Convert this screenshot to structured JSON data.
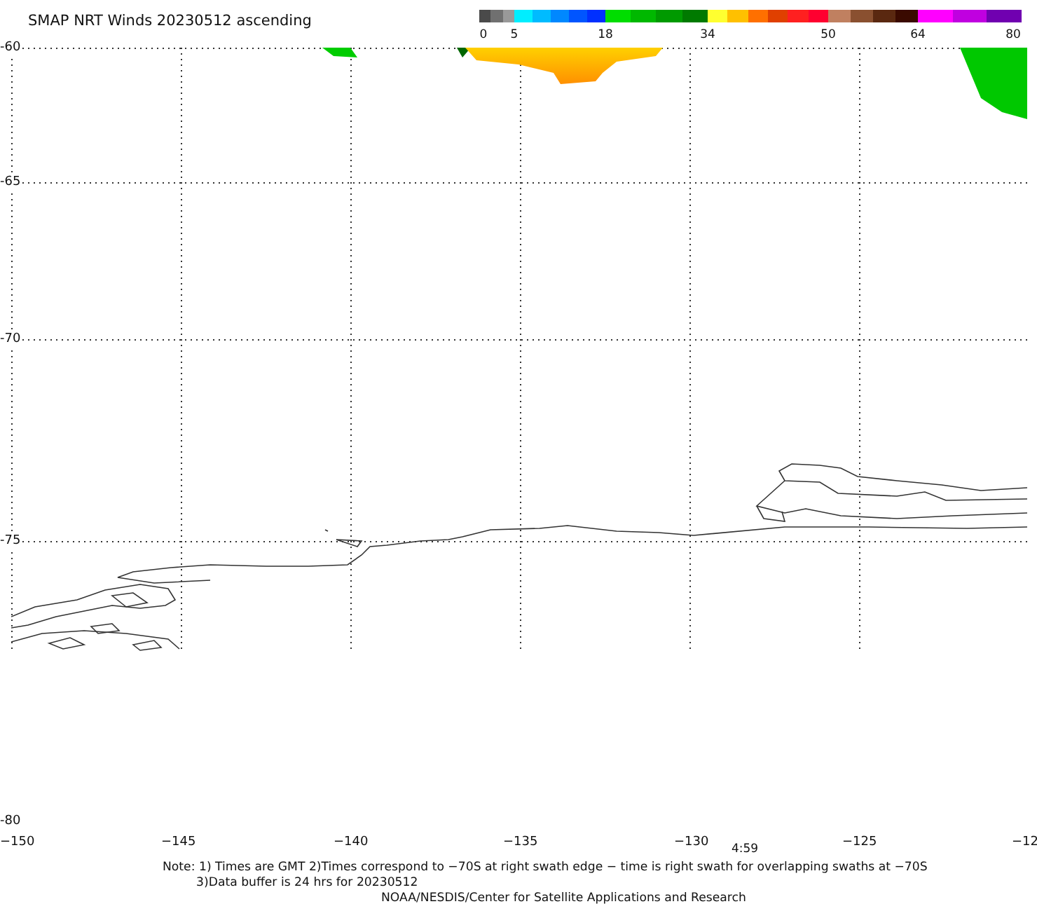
{
  "title": "SMAP NRT Winds 20230512 ascending",
  "colorbar": {
    "ticks": [
      "0",
      "5",
      "18",
      "34",
      "50",
      "64",
      "80"
    ],
    "bands": [
      {
        "steps": [
          {
            "color": "#4a4a4a"
          },
          {
            "color": "#707070"
          },
          {
            "color": "#999999"
          }
        ]
      },
      {
        "steps": [
          {
            "color": "#00eeff"
          },
          {
            "color": "#00bbff"
          },
          {
            "color": "#0088ff"
          },
          {
            "color": "#0055ff"
          },
          {
            "color": "#0030ff"
          }
        ]
      },
      {
        "steps": [
          {
            "color": "#00dd00"
          },
          {
            "color": "#00b800"
          },
          {
            "color": "#009a00"
          },
          {
            "color": "#007a00"
          }
        ]
      },
      {
        "steps": [
          {
            "color": "#ffff30"
          },
          {
            "color": "#ffc000"
          },
          {
            "color": "#ff7000"
          },
          {
            "color": "#e04000"
          },
          {
            "color": "#ff2020"
          },
          {
            "color": "#ff0030"
          }
        ]
      },
      {
        "steps": [
          {
            "color": "#c08060"
          },
          {
            "color": "#8a5030"
          },
          {
            "color": "#5a2810"
          },
          {
            "color": "#3a0a00"
          }
        ]
      },
      {
        "steps": [
          {
            "color": "#ff00ff"
          },
          {
            "color": "#c000e0"
          },
          {
            "color": "#7000b0"
          }
        ]
      }
    ]
  },
  "map": {
    "latitude_labels": [
      "-60",
      "-65",
      "-70",
      "-75",
      "-80"
    ],
    "longitude_labels": [
      "−150",
      "−145",
      "−140",
      "−135",
      "−130",
      "−125",
      "−12"
    ],
    "time_label": "4:59"
  },
  "notes": [
    "Note: 1) Times are GMT 2)Times correspond to −70S at right swath edge − time is right swath for overlapping swaths at −70S",
    "3)Data buffer is 24 hrs for 20230512",
    "NOAA/NESDIS/Center for Satellite Applications and Research"
  ]
}
